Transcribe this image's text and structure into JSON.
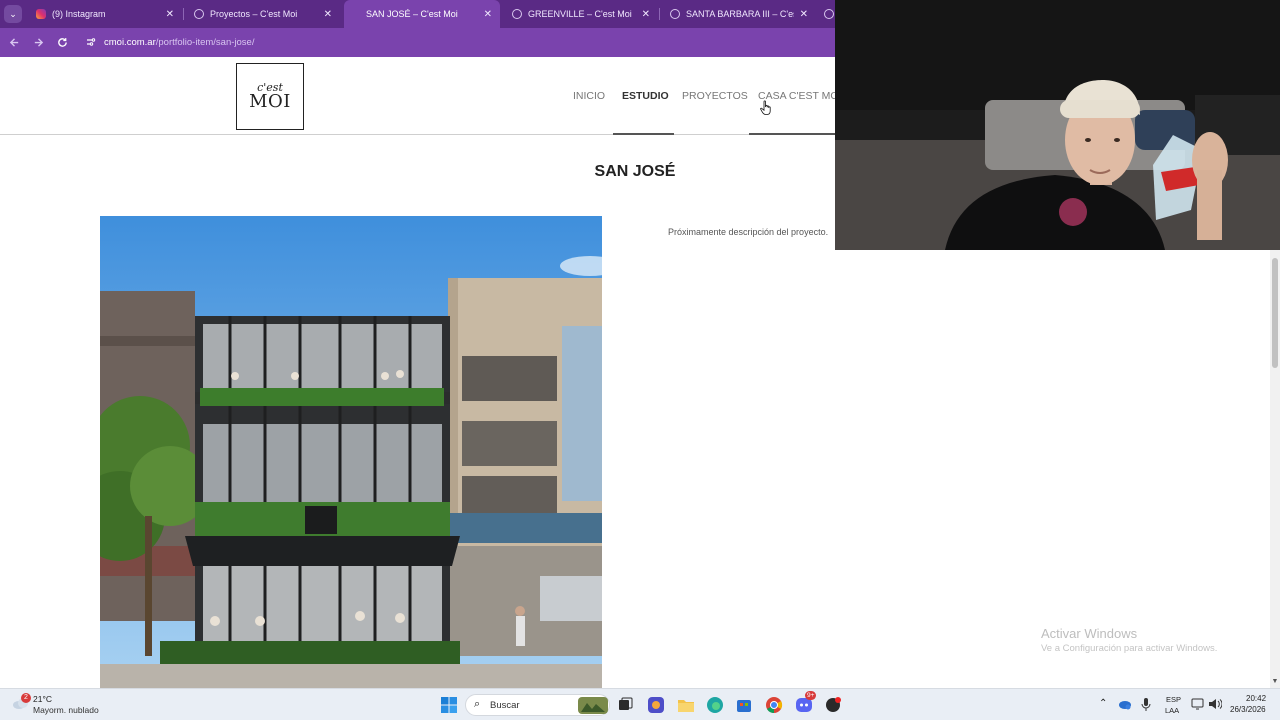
{
  "browser": {
    "tabs": [
      {
        "title": "(9) Instagram",
        "active": false,
        "icon": "instagram-icon"
      },
      {
        "title": "Proyectos – C'est Moi",
        "active": false,
        "icon": "globe-icon"
      },
      {
        "title": "SAN JOSÉ – C'est Moi",
        "active": true,
        "icon": "globe-icon"
      },
      {
        "title": "GREENVILLE – C'est Moi",
        "active": false,
        "icon": "globe-icon"
      },
      {
        "title": "SANTA BARBARA III – C'est Moi",
        "active": false,
        "icon": "globe-icon"
      }
    ],
    "close_glyph": "✕",
    "url_host": "cmoi.com.ar",
    "url_path": "/portfolio-item/san-jose/",
    "accent": "#7a43ad",
    "tabstrip_color": "#5a2a85"
  },
  "site": {
    "logo_line1": "c'est",
    "logo_line2": "MOI",
    "nav": [
      "INICIO",
      "ESTUDIO",
      "PROYECTOS",
      "CASA C'EST MOI"
    ],
    "active_nav": "ESTUDIO",
    "title": "SAN JOSÉ",
    "description": "Próximamente descripción del proyecto."
  },
  "watermark": {
    "title": "Activar Windows",
    "subtitle": "Ve a Configuración para activar Windows."
  },
  "taskbar": {
    "weather_badge": "2",
    "temperature": "21°C",
    "weather_desc": "Mayorm. nublado",
    "search_placeholder": "Buscar",
    "lang_line1": "ESP",
    "lang_line2": "LAA",
    "time": "20:42",
    "date": "26/3/2026",
    "notification_count": "9+"
  }
}
